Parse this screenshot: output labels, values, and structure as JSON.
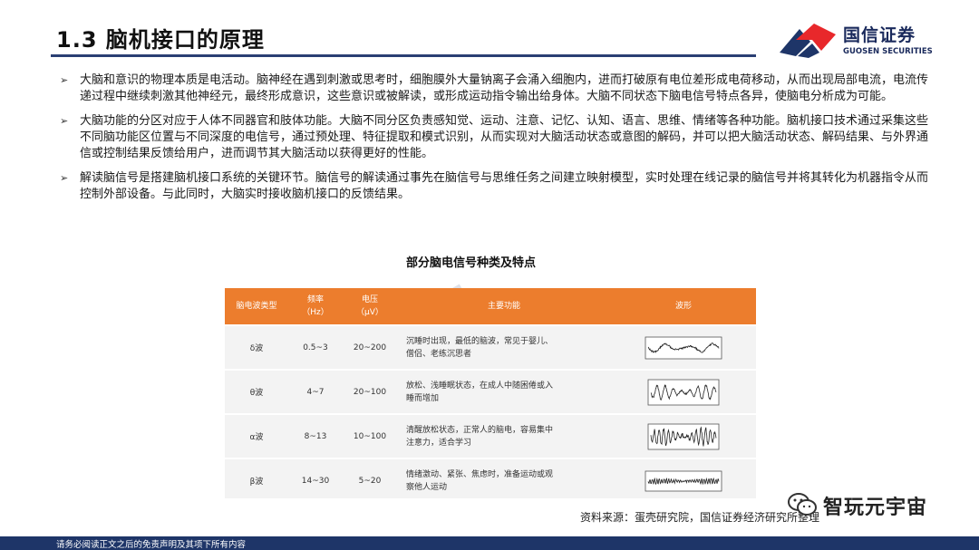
{
  "header": {
    "title": "1.3 脑机接口的原理",
    "logo_name": "国信证券",
    "logo_sub": "GUOSEN SECURITIES"
  },
  "bullets": [
    "大脑和意识的物理本质是电活动。脑神经在遇到刺激或思考时，细胞膜外大量钠离子会涌入细胞内，进而打破原有电位差形成电荷移动，从而出现局部电流，电流传递过程中继续刺激其他神经元，最终形成意识，这些意识或被解读，或形成运动指令输出给身体。大脑不同状态下脑电信号特点各异，使脑电分析成为可能。",
    "大脑功能的分区对应于人体不同器官和肢体功能。大脑不同分区负责感知觉、运动、注意、记忆、认知、语言、思维、情绪等各种功能。脑机接口技术通过采集这些不同脑功能区位置与不同深度的电信号，通过预处理、特征提取和模式识别，从而实现对大脑活动状态或意图的解码，并可以把大脑活动状态、解码结果、与外界通信或控制结果反馈给用户，进而调节其大脑活动以获得更好的性能。",
    "解读脑信号是搭建脑机接口系统的关键环节。脑信号的解读通过事先在脑信号与思维任务之间建立映射模型，实时处理在线记录的脑信号并将其转化为机器指令从而控制外部设备。与此同时，大脑实时接收脑机接口的反馈结果。"
  ],
  "table": {
    "caption": "部分脑电信号种类及特点",
    "headers": {
      "type": "脑电波类型",
      "freq_line1": "频率",
      "freq_line2": "（Hz）",
      "volt_line1": "电压",
      "volt_line2": "（μV）",
      "func": "主要功能",
      "wave": "波形"
    },
    "rows": [
      {
        "type": "δ波",
        "freq": "0.5~3",
        "volt": "20~200",
        "func1": "沉睡时出现，最低的脑波，常见于婴儿、",
        "func2": "僧侣、老练沉思者",
        "wave": "delta"
      },
      {
        "type": "θ波",
        "freq": "4~7",
        "volt": "20~100",
        "func1": "放松、浅睡眠状态，在成人中随困倦或入",
        "func2": "睡而增加",
        "wave": "theta"
      },
      {
        "type": "α波",
        "freq": "8~13",
        "volt": "10~100",
        "func1": "清醒放松状态，正常人的脑电，容易集中",
        "func2": "注意力，适合学习",
        "wave": "alpha"
      },
      {
        "type": "β波",
        "freq": "14~30",
        "volt": "5~20",
        "func1": "情绪激动、紧张、焦虑时，准备运动或观",
        "func2": "察他人运动",
        "wave": "beta"
      }
    ]
  },
  "source": "资料来源：蛋壳研究院，国信证券经济研究所整理",
  "wechat_name": "智玩元宇宙",
  "footer": "请务必阅读正文之后的免责声明及其项下所有内容",
  "colors": {
    "accent": "#ec7d2d",
    "brand": "#1e3568",
    "logo_red": "#e8282b"
  }
}
